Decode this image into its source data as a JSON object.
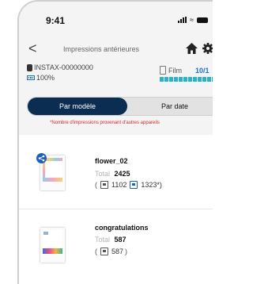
{
  "status_bar": {
    "time": "9:41"
  },
  "nav": {
    "title": "Impressions antérieures",
    "back_glyph": "<"
  },
  "device": {
    "name": "INSTAX-00000000",
    "battery": "100%",
    "film_label": "Film",
    "film_count": "10/1"
  },
  "tabs": [
    {
      "label": "Par modèle",
      "active": true
    },
    {
      "label": "Par date",
      "active": false
    }
  ],
  "note": "*Nombre d'impressions provenant d'autres appareils",
  "items": [
    {
      "name": "flower_02",
      "total_label": "Total",
      "total_value": "2425",
      "paren_open": "(",
      "own_prints": "1102",
      "other_prints": "1323*)",
      "shared": true
    },
    {
      "name": "congratulations",
      "total_label": "Total",
      "total_value": "587",
      "paren_open": "(",
      "own_prints": "587",
      "paren_close": ")",
      "shared": false
    }
  ],
  "colors": {
    "accent": "#0c2d52",
    "note_red": "#d8272e",
    "film_bar": "#2bb3c4",
    "link_blue": "#1f5fb8"
  },
  "icons": [
    "back-icon",
    "home-icon",
    "gear-icon",
    "camera-icon",
    "battery-icon",
    "film-icon",
    "print-icon",
    "share-icon"
  ]
}
